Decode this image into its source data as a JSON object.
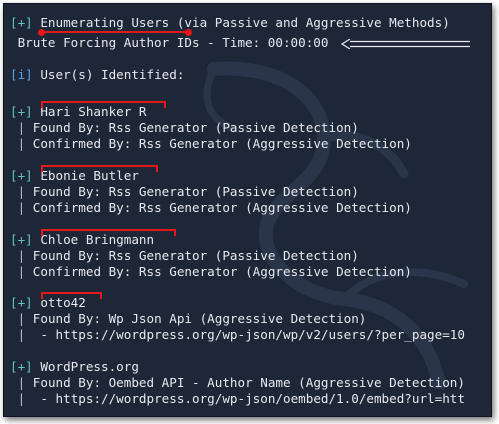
{
  "header": {
    "tag": "[+]",
    "title": "Enumerating Users (via Passive and Aggressive Methods)",
    "progress": " Brute Forcing Author IDs - Time: 00:00:00 "
  },
  "identified": {
    "tag": "[i]",
    "text": "User(s) Identified:"
  },
  "users": [
    {
      "tag": "[+]",
      "name": "Hari Shanker R",
      "lines": [
        "Found By: Rss Generator (Passive Detection)",
        "Confirmed By: Rss Generator (Aggressive Detection)"
      ]
    },
    {
      "tag": "[+]",
      "name": "Ebonie Butler",
      "lines": [
        "Found By: Rss Generator (Passive Detection)",
        "Confirmed By: Rss Generator (Aggressive Detection)"
      ]
    },
    {
      "tag": "[+]",
      "name": "Chloe Bringmann",
      "lines": [
        "Found By: Rss Generator (Passive Detection)",
        "Confirmed By: Rss Generator (Aggressive Detection)"
      ]
    },
    {
      "tag": "[+]",
      "name": "otto42",
      "lines": [
        "Found By: Wp Json Api (Aggressive Detection)",
        " - https://wordpress.org/wp-json/wp/v2/users/?per_page=10"
      ]
    },
    {
      "tag": "[+]",
      "name": "WordPress.org",
      "lines": [
        "Found By: Oembed API - Author Name (Aggressive Detection)",
        " - https://wordpress.org/wp-json/oembed/1.0/embed?url=htt"
      ]
    }
  ],
  "bar_char": "|",
  "colors": {
    "background": "#1d2738",
    "text": "#e6e9ef",
    "tag": "#5ec6ba",
    "info_tag": "#5aa0e6",
    "annotation": "#e41818"
  }
}
